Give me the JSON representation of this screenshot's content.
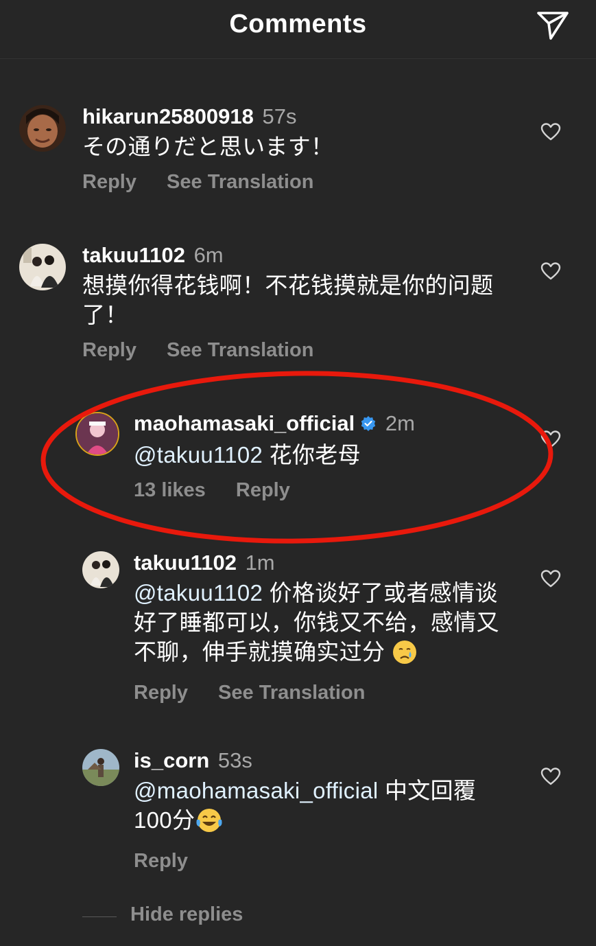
{
  "header": {
    "title": "Comments",
    "send_icon": "paper-plane-icon"
  },
  "colors": {
    "background": "#262626",
    "secondary_text": "#8e8e8e",
    "verified_blue": "#3897f0",
    "annotation_red": "#e8190c"
  },
  "comments": [
    {
      "username": "hikarun25800918",
      "time": "57s",
      "text": "その通りだと思います！",
      "actions": [
        "Reply",
        "See Translation"
      ],
      "verified": false
    },
    {
      "username": "takuu1102",
      "time": "6m",
      "text": "想摸你得花钱啊！不花钱摸就是你的问题了！",
      "actions": [
        "Reply",
        "See Translation"
      ],
      "verified": false
    },
    {
      "username": "maohamasaki_official",
      "time": "2m",
      "mention": "@takuu1102",
      "text": " 花你老母",
      "likes": "13 likes",
      "actions": [
        "Reply"
      ],
      "verified": true
    },
    {
      "username": "takuu1102",
      "time": "1m",
      "mention": "@takuu1102",
      "text": " 价格谈好了或者感情谈好了睡都可以，你钱又不给，感情又不聊，伸手就摸确实过分",
      "emoji": "crying-face-emoji",
      "actions": [
        "Reply",
        "See Translation"
      ],
      "verified": false
    },
    {
      "username": "is_corn",
      "time": "53s",
      "mention": "@maohamasaki_official",
      "text": " 中文回覆100分",
      "emoji": "tears-of-joy-emoji",
      "actions": [
        "Reply"
      ],
      "verified": false
    }
  ],
  "hide_replies": "Hide replies"
}
